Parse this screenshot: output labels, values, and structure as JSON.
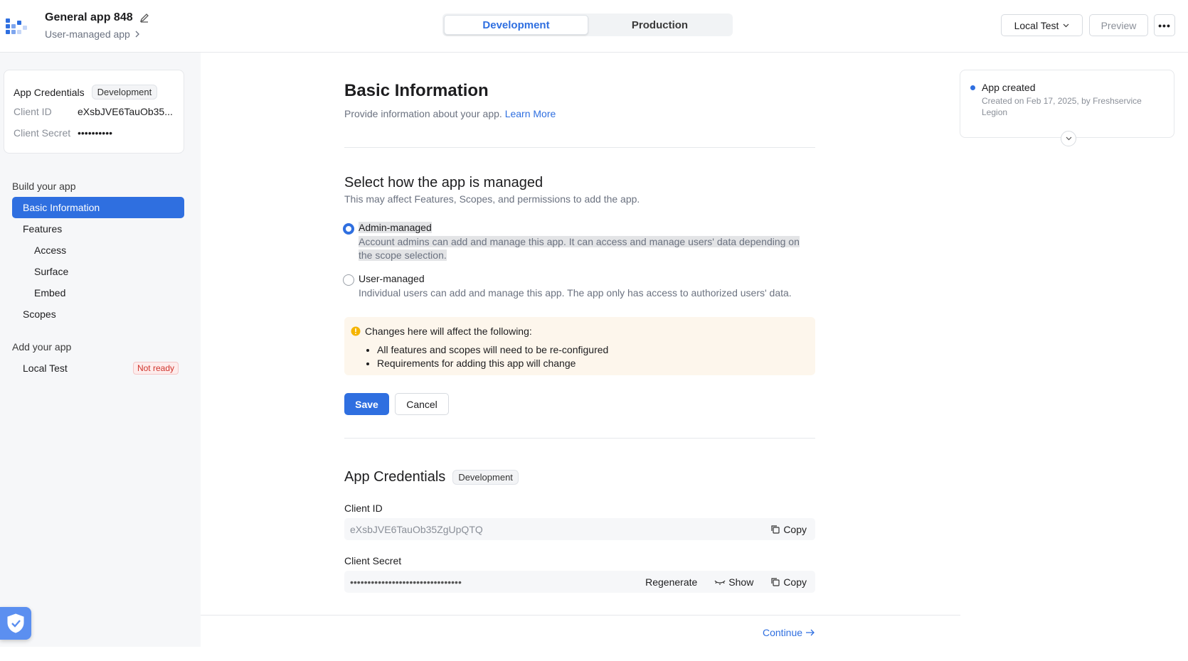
{
  "header": {
    "app_title": "General app 848",
    "app_subtitle": "User-managed app",
    "env_tabs": [
      "Development",
      "Production"
    ],
    "active_env": "Development",
    "local_test_label": "Local Test",
    "preview_label": "Preview",
    "more_label": "•••"
  },
  "sidebar": {
    "credentials_card": {
      "title": "App Credentials",
      "badge": "Development",
      "client_id_label": "Client ID",
      "client_id_value": "eXsbJVE6TauOb35...",
      "client_secret_label": "Client Secret",
      "client_secret_value": "••••••••••"
    },
    "build_section_label": "Build your app",
    "items": [
      {
        "label": "Basic Information"
      },
      {
        "label": "Features"
      },
      {
        "label": "Access"
      },
      {
        "label": "Surface"
      },
      {
        "label": "Embed"
      },
      {
        "label": "Scopes"
      }
    ],
    "add_section_label": "Add your app",
    "local_test_label": "Local Test",
    "local_test_badge": "Not ready"
  },
  "main": {
    "title": "Basic Information",
    "description": "Provide information about your app.",
    "learn_more": "Learn More",
    "managed_title": "Select how the app is managed",
    "managed_sub": "This may affect Features, Scopes, and permissions to add the app.",
    "options": [
      {
        "label": "Admin-managed",
        "description": "Account admins can add and manage this app. It can access and manage users' data depending on the scope selection.",
        "selected": true
      },
      {
        "label": "User-managed",
        "description": "Individual users can add and manage this app. The app only has access to authorized users' data.",
        "selected": false
      }
    ],
    "warning": {
      "heading": "Changes here will affect the following:",
      "items": [
        "All features and scopes will need to be re-configured",
        "Requirements for adding this app will change"
      ]
    },
    "save_label": "Save",
    "cancel_label": "Cancel",
    "credentials": {
      "title": "App Credentials",
      "badge": "Development",
      "client_id_label": "Client ID",
      "client_id_value": "eXsbJVE6TauOb35ZgUpQTQ",
      "client_secret_label": "Client Secret",
      "client_secret_value": "••••••••••••••••••••••••••••••••",
      "copy_label": "Copy",
      "regenerate_label": "Regenerate",
      "show_label": "Show"
    },
    "continue_label": "Continue"
  },
  "activity": {
    "title": "App created",
    "description": "Created on Feb 17, 2025, by Freshservice Legion"
  },
  "colors": {
    "accent": "#2f6fe0",
    "sidebar_bg": "#f6f7f9",
    "warning_bg": "#fdf6ec",
    "danger": "#d0342c"
  }
}
